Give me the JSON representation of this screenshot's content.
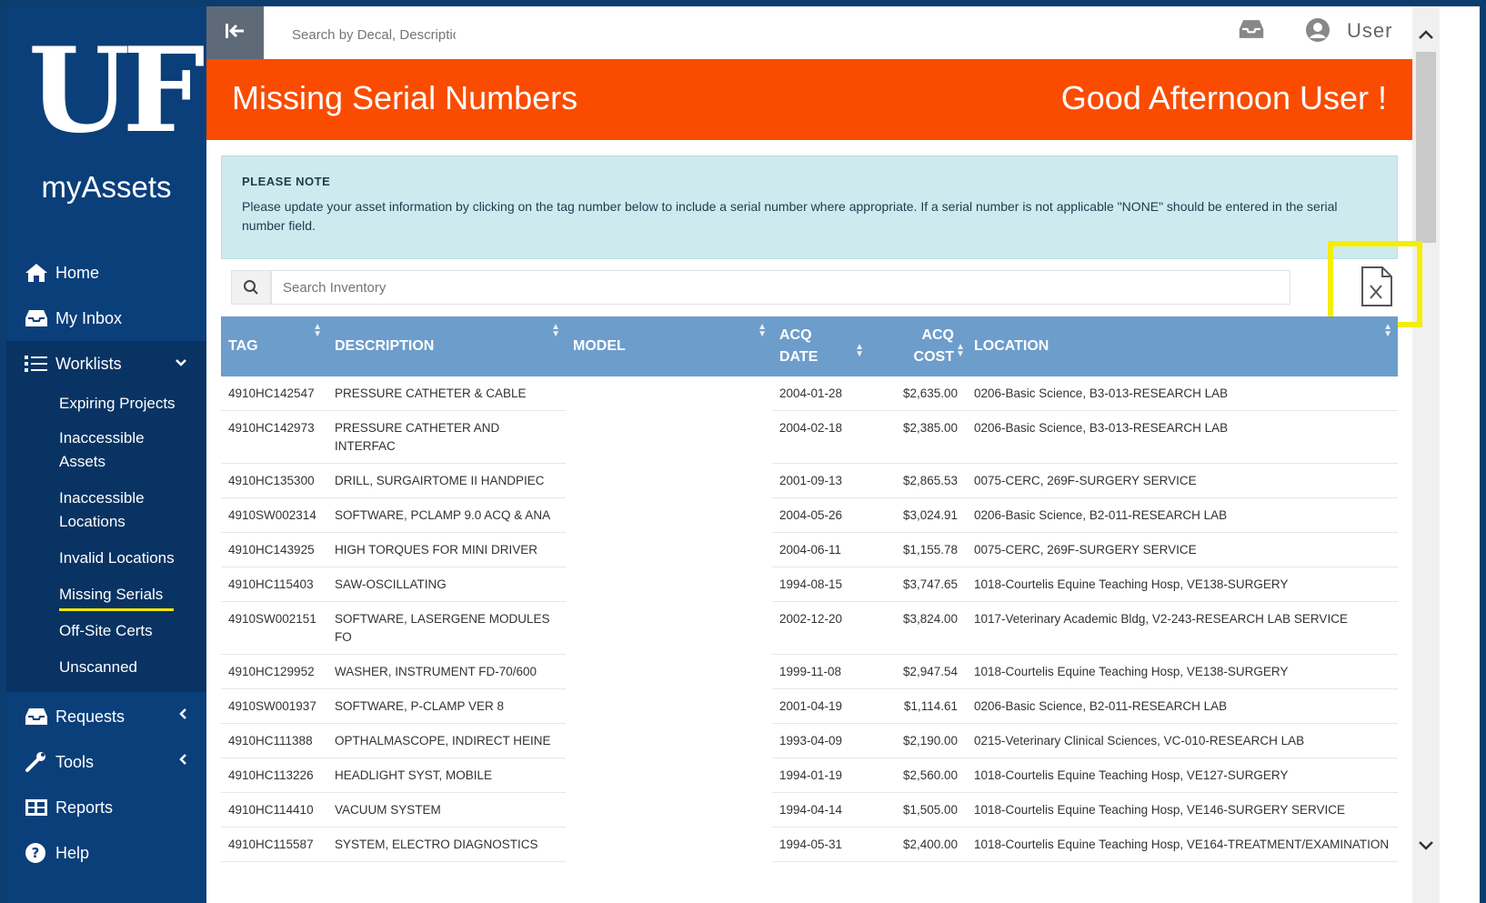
{
  "sidebar": {
    "logo": "UF",
    "app_name": "myAssets",
    "nav": {
      "home": "Home",
      "inbox": "My Inbox",
      "worklists": "Worklists",
      "requests": "Requests",
      "tools": "Tools",
      "reports": "Reports",
      "help": "Help"
    },
    "worklist_items": [
      "Expiring Projects",
      "Inaccessible Assets",
      "Inaccessible Locations",
      "Invalid Locations",
      "Missing Serials",
      "Off-Site Certs",
      "Unscanned"
    ],
    "active_item": "Missing Serials"
  },
  "topbar": {
    "search_placeholder": "Search by Decal, Description",
    "user_label": "User"
  },
  "banner": {
    "title": "Missing Serial Numbers",
    "greeting": "Good Afternoon User !"
  },
  "note": {
    "title": "PLEASE NOTE",
    "body": "Please update your asset information by clicking on the tag number below to include a serial number where appropriate. If a serial number is not applicable \"NONE\" should be entered in the serial number field."
  },
  "inventory_search": {
    "placeholder": "Search Inventory"
  },
  "table": {
    "headers": {
      "tag": "TAG",
      "description": "DESCRIPTION",
      "model": "MODEL",
      "acq_date_1": "ACQ",
      "acq_date_2": "DATE",
      "acq_cost_1": "ACQ",
      "acq_cost_2": "COST",
      "location": "LOCATION"
    },
    "rows": [
      {
        "tag": "4910HC142547",
        "description": "PRESSURE CATHETER & CABLE",
        "model": "",
        "date": "2004-01-28",
        "cost": "$2,635.00",
        "location": "0206-Basic Science, B3-013-RESEARCH LAB"
      },
      {
        "tag": "4910HC142973",
        "description": "PRESSURE CATHETER AND INTERFAC",
        "model": "",
        "date": "2004-02-18",
        "cost": "$2,385.00",
        "location": "0206-Basic Science, B3-013-RESEARCH LAB"
      },
      {
        "tag": "4910HC135300",
        "description": "DRILL, SURGAIRTOME II HANDPIEC",
        "model": "",
        "date": "2001-09-13",
        "cost": "$2,865.53",
        "location": "0075-CERC, 269F-SURGERY SERVICE"
      },
      {
        "tag": "4910SW002314",
        "description": "SOFTWARE, PCLAMP 9.0 ACQ & ANA",
        "model": "",
        "date": "2004-05-26",
        "cost": "$3,024.91",
        "location": "0206-Basic Science, B2-011-RESEARCH LAB"
      },
      {
        "tag": "4910HC143925",
        "description": "HIGH TORQUES FOR MINI DRIVER",
        "model": "",
        "date": "2004-06-11",
        "cost": "$1,155.78",
        "location": "0075-CERC, 269F-SURGERY SERVICE"
      },
      {
        "tag": "4910HC115403",
        "description": "SAW-OSCILLATING",
        "model": "",
        "date": "1994-08-15",
        "cost": "$3,747.65",
        "location": "1018-Courtelis Equine Teaching Hosp, VE138-SURGERY"
      },
      {
        "tag": "4910SW002151",
        "description": "SOFTWARE, LASERGENE MODULES FO",
        "model": "",
        "date": "2002-12-20",
        "cost": "$3,824.00",
        "location": "1017-Veterinary Academic Bldg, V2-243-RESEARCH LAB SERVICE"
      },
      {
        "tag": "4910HC129952",
        "description": "WASHER, INSTRUMENT FD-70/600",
        "model": "",
        "date": "1999-11-08",
        "cost": "$2,947.54",
        "location": "1018-Courtelis Equine Teaching Hosp, VE138-SURGERY"
      },
      {
        "tag": "4910SW001937",
        "description": "SOFTWARE, P-CLAMP VER 8",
        "model": "",
        "date": "2001-04-19",
        "cost": "$1,114.61",
        "location": "0206-Basic Science, B2-011-RESEARCH LAB"
      },
      {
        "tag": "4910HC111388",
        "description": "OPTHALMASCOPE, INDIRECT HEINE",
        "model": "",
        "date": "1993-04-09",
        "cost": "$2,190.00",
        "location": "0215-Veterinary Clinical Sciences, VC-010-RESEARCH LAB"
      },
      {
        "tag": "4910HC113226",
        "description": "HEADLIGHT SYST, MOBILE",
        "model": "",
        "date": "1994-01-19",
        "cost": "$2,560.00",
        "location": "1018-Courtelis Equine Teaching Hosp, VE127-SURGERY"
      },
      {
        "tag": "4910HC114410",
        "description": "VACUUM SYSTEM",
        "model": "",
        "date": "1994-04-14",
        "cost": "$1,505.00",
        "location": "1018-Courtelis Equine Teaching Hosp, VE146-SURGERY SERVICE"
      },
      {
        "tag": "4910HC115587",
        "description": "SYSTEM, ELECTRO DIAGNOSTICS",
        "model": "",
        "date": "1994-05-31",
        "cost": "$2,400.00",
        "location": "1018-Courtelis Equine Teaching Hosp, VE164-TREATMENT/EXAMINATION"
      }
    ]
  },
  "colors": {
    "sidebar": "#0b3f7a",
    "banner": "#fa4c00",
    "table_header": "#6d9dcb",
    "note_bg": "#cfeaee",
    "highlight": "#f5ee00"
  }
}
